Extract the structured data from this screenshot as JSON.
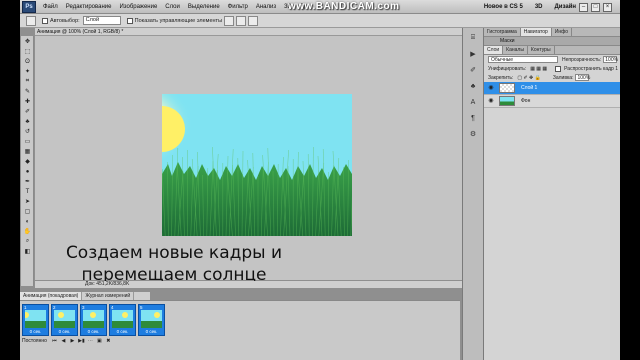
{
  "menubar": {
    "logo": "Ps",
    "items": [
      "Файл",
      "Редактирование",
      "Изображение",
      "Слои",
      "Выделение",
      "Фильтр",
      "Анализ",
      "3D",
      "Пр"
    ],
    "watermark": "www.BANDICAM.com",
    "workspace_new": "Новое в CS 5",
    "workspace_3d": "3D",
    "workspace_design": "Дизайн"
  },
  "options": {
    "autoselect_label": "Автовыбор:",
    "autoselect_value": "Слой",
    "show_controls_label": "Показать управляющие элементы"
  },
  "document": {
    "tab_title": "Анимация @ 100% (Слой 1, RGB/8) *",
    "status": "Док: 451,2K/836,8K",
    "caption_line1": "Создаем новые кадры и",
    "caption_line2": "перемещаем солнце"
  },
  "animation": {
    "tabs": [
      "Анимация (покадровая)",
      "Журнал измерений"
    ],
    "frames": [
      {
        "num": "1",
        "delay": "0 сек."
      },
      {
        "num": "2",
        "delay": "0 сек."
      },
      {
        "num": "3",
        "delay": "0 сек."
      },
      {
        "num": "4",
        "delay": "0 сек."
      },
      {
        "num": "5",
        "delay": "0 сек."
      }
    ],
    "loop": "Постоянно"
  },
  "right_panel": {
    "top_tabs": [
      "Гистограмма",
      "Навигатор",
      "Инфо"
    ],
    "masks_label": "Маски",
    "layer_tabs": [
      "Слои",
      "Каналы",
      "Контуры"
    ],
    "blend_mode": "Обычные",
    "opacity_label": "Непрозрачность:",
    "opacity_value": "100%",
    "unify_label": "Унифицировать:",
    "propagate_label": "Распространить кадр 1",
    "lock_label": "Закрепить:",
    "fill_label": "Заливка:",
    "fill_value": "100%",
    "layers": [
      {
        "name": "Слой 1",
        "selected": true
      },
      {
        "name": "Фон",
        "selected": false
      }
    ]
  },
  "colors": {
    "sky": "#7fe3f2",
    "grass": "#2e8b3a",
    "selection": "#2f8fe8"
  }
}
